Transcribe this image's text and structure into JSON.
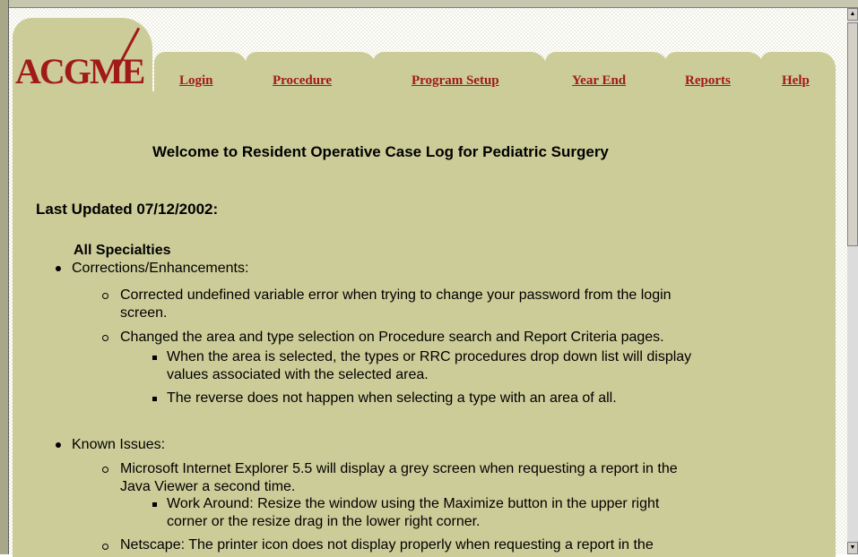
{
  "brand": {
    "logo_text": "ACGME"
  },
  "nav": {
    "login": "Login",
    "procedure": "Procedure",
    "program_setup": "Program Setup",
    "year_end": "Year End",
    "reports": "Reports",
    "help": "Help"
  },
  "content": {
    "welcome": "Welcome to Resident Operative Case Log for Pediatric Surgery",
    "last_updated": "Last Updated 07/12/2002:",
    "section_heading": "All Specialties",
    "corrections": {
      "label": "Corrections/Enhancements:",
      "item1_line1": "Corrected undefined variable error when trying to change your password from the login",
      "item1_line2": "screen.",
      "item2": "Changed the area and type selection on Procedure search and Report Criteria pages.",
      "sub1_line1": "When the area is selected, the types or RRC procedures drop down list will display",
      "sub1_line2": "values associated with the selected area.",
      "sub2": "The reverse does not happen when selecting a type with an area of all."
    },
    "known_issues": {
      "label": "Known Issues:",
      "item1_line1": "Microsoft Internet Explorer 5.5 will display a grey screen when requesting a report in the",
      "item1_line2": "Java Viewer a second time.",
      "sub1_line1": "Work Around: Resize the window using the Maximize button in the upper right",
      "sub1_line2": "corner or the resize drag in the lower right corner.",
      "item2": "Netscape: The printer icon does not display properly when requesting a report in the"
    }
  }
}
